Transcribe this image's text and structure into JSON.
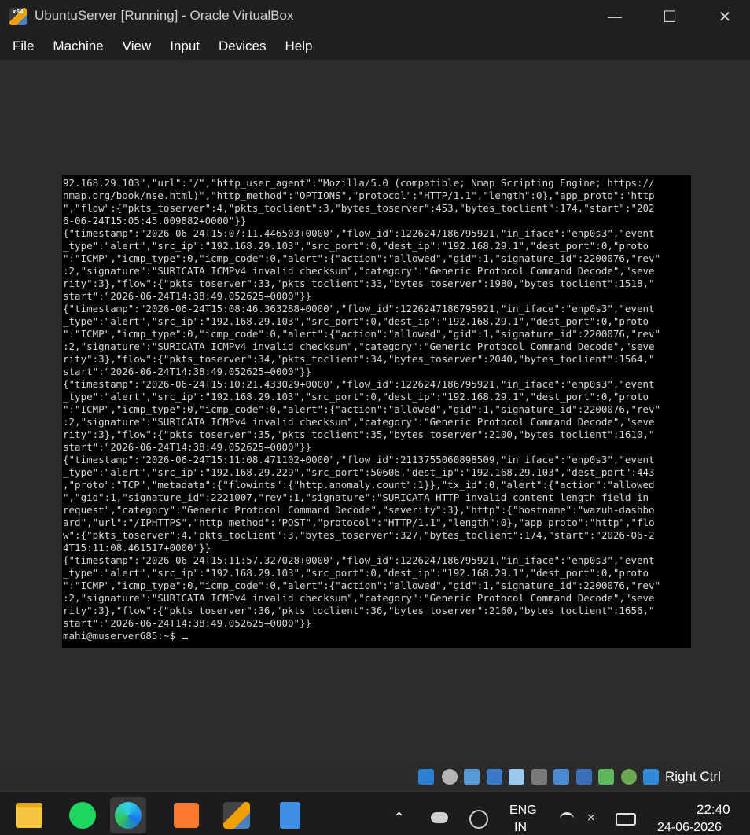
{
  "window": {
    "title": "UbuntuServer [Running] - Oracle VirtualBox",
    "app_icon_label": "x64",
    "minimize_glyph": "—",
    "maximize_glyph": "☐",
    "close_glyph": "✕"
  },
  "menu": {
    "file": "File",
    "machine": "Machine",
    "view": "View",
    "input": "Input",
    "devices": "Devices",
    "help": "Help"
  },
  "terminal": {
    "lines": [
      "92.168.29.103\",\"url\":\"/\",\"http_user_agent\":\"Mozilla/5.0 (compatible; Nmap Scripting Engine; https://",
      "nmap.org/book/nse.html)\",\"http_method\":\"OPTIONS\",\"protocol\":\"HTTP/1.1\",\"length\":0},\"app_proto\":\"http",
      "\",\"flow\":{\"pkts_toserver\":4,\"pkts_toclient\":3,\"bytes_toserver\":453,\"bytes_toclient\":174,\"start\":\"202",
      "6-06-24T15:05:45.009882+0000\"}}",
      "{\"timestamp\":\"2026-06-24T15:07:11.446503+0000\",\"flow_id\":1226247186795921,\"in_iface\":\"enp0s3\",\"event",
      "_type\":\"alert\",\"src_ip\":\"192.168.29.103\",\"src_port\":0,\"dest_ip\":\"192.168.29.1\",\"dest_port\":0,\"proto",
      "\":\"ICMP\",\"icmp_type\":0,\"icmp_code\":0,\"alert\":{\"action\":\"allowed\",\"gid\":1,\"signature_id\":2200076,\"rev\"",
      ":2,\"signature\":\"SURICATA ICMPv4 invalid checksum\",\"category\":\"Generic Protocol Command Decode\",\"seve",
      "rity\":3},\"flow\":{\"pkts_toserver\":33,\"pkts_toclient\":33,\"bytes_toserver\":1980,\"bytes_toclient\":1518,\"",
      "start\":\"2026-06-24T14:38:49.052625+0000\"}}",
      "{\"timestamp\":\"2026-06-24T15:08:46.363288+0000\",\"flow_id\":1226247186795921,\"in_iface\":\"enp0s3\",\"event",
      "_type\":\"alert\",\"src_ip\":\"192.168.29.103\",\"src_port\":0,\"dest_ip\":\"192.168.29.1\",\"dest_port\":0,\"proto",
      "\":\"ICMP\",\"icmp_type\":0,\"icmp_code\":0,\"alert\":{\"action\":\"allowed\",\"gid\":1,\"signature_id\":2200076,\"rev\"",
      ":2,\"signature\":\"SURICATA ICMPv4 invalid checksum\",\"category\":\"Generic Protocol Command Decode\",\"seve",
      "rity\":3},\"flow\":{\"pkts_toserver\":34,\"pkts_toclient\":34,\"bytes_toserver\":2040,\"bytes_toclient\":1564,\"",
      "start\":\"2026-06-24T14:38:49.052625+0000\"}}",
      "{\"timestamp\":\"2026-06-24T15:10:21.433029+0000\",\"flow_id\":1226247186795921,\"in_iface\":\"enp0s3\",\"event",
      "_type\":\"alert\",\"src_ip\":\"192.168.29.103\",\"src_port\":0,\"dest_ip\":\"192.168.29.1\",\"dest_port\":0,\"proto",
      "\":\"ICMP\",\"icmp_type\":0,\"icmp_code\":0,\"alert\":{\"action\":\"allowed\",\"gid\":1,\"signature_id\":2200076,\"rev\"",
      ":2,\"signature\":\"SURICATA ICMPv4 invalid checksum\",\"category\":\"Generic Protocol Command Decode\",\"seve",
      "rity\":3},\"flow\":{\"pkts_toserver\":35,\"pkts_toclient\":35,\"bytes_toserver\":2100,\"bytes_toclient\":1610,\"",
      "start\":\"2026-06-24T14:38:49.052625+0000\"}}",
      "{\"timestamp\":\"2026-06-24T15:11:08.471102+0000\",\"flow_id\":2113755060898509,\"in_iface\":\"enp0s3\",\"event",
      "_type\":\"alert\",\"src_ip\":\"192.168.29.229\",\"src_port\":50606,\"dest_ip\":\"192.168.29.103\",\"dest_port\":443",
      ",\"proto\":\"TCP\",\"metadata\":{\"flowints\":{\"http.anomaly.count\":1}},\"tx_id\":0,\"alert\":{\"action\":\"allowed",
      "\",\"gid\":1,\"signature_id\":2221007,\"rev\":1,\"signature\":\"SURICATA HTTP invalid content length field in ",
      "request\",\"category\":\"Generic Protocol Command Decode\",\"severity\":3},\"http\":{\"hostname\":\"wazuh-dashbo",
      "ard\",\"url\":\"/IPHTTPS\",\"http_method\":\"POST\",\"protocol\":\"HTTP/1.1\",\"length\":0},\"app_proto\":\"http\",\"flo",
      "w\":{\"pkts_toserver\":4,\"pkts_toclient\":3,\"bytes_toserver\":327,\"bytes_toclient\":174,\"start\":\"2026-06-2",
      "4T15:11:08.461517+0000\"}}",
      "{\"timestamp\":\"2026-06-24T15:11:57.327028+0000\",\"flow_id\":1226247186795921,\"in_iface\":\"enp0s3\",\"event",
      "_type\":\"alert\",\"src_ip\":\"192.168.29.103\",\"src_port\":0,\"dest_ip\":\"192.168.29.1\",\"dest_port\":0,\"proto",
      "\":\"ICMP\",\"icmp_type\":0,\"icmp_code\":0,\"alert\":{\"action\":\"allowed\",\"gid\":1,\"signature_id\":2200076,\"rev\"",
      ":2,\"signature\":\"SURICATA ICMPv4 invalid checksum\",\"category\":\"Generic Protocol Command Decode\",\"seve",
      "rity\":3},\"flow\":{\"pkts_toserver\":36,\"pkts_toclient\":36,\"bytes_toserver\":2160,\"bytes_toclient\":1656,\"",
      "start\":\"2026-06-24T14:38:49.052625+0000\"}}"
    ],
    "prompt": "mahi@muserver685:~$ "
  },
  "statusbar": {
    "icons": [
      "hard-disk-icon",
      "optical-drive-icon",
      "audio-icon",
      "network-icon",
      "usb-icon",
      "shared-folders-icon",
      "display-icon",
      "recording-icon",
      "cpu-icon",
      "mouse-integration-icon",
      "host-key-icon"
    ],
    "host_key_label": "Right Ctrl"
  },
  "taskbar": {
    "apps": [
      "file-explorer-icon",
      "spotify-icon",
      "edge-icon",
      "virtualstudio-icon",
      "virtualbox-icon",
      "notepad-icon"
    ],
    "chevron_glyph": "⌃",
    "language_line1": "ENG",
    "language_line2": "IN",
    "time": "22:40",
    "date": "24-06-2026"
  },
  "colors": {
    "titlebar": "#1f1f1f",
    "vm_background": "#2c2c2c",
    "terminal_bg": "#000000",
    "terminal_fg": "#d8d8d8",
    "taskbar": "#1c1c1c"
  }
}
